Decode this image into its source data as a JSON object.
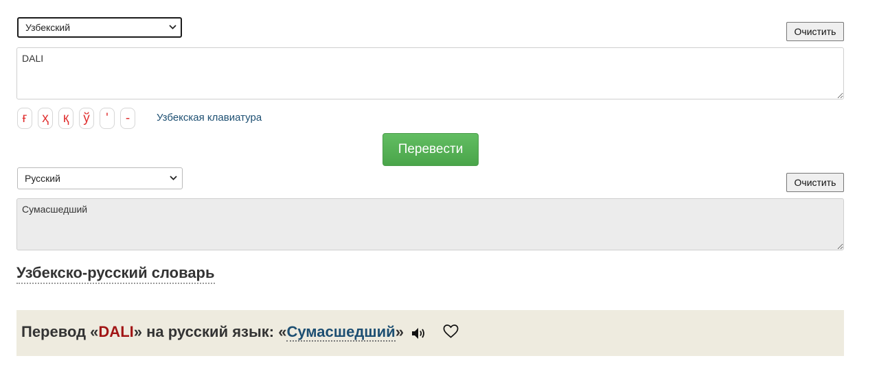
{
  "source": {
    "language": "Узбекский",
    "text": "DALI",
    "clear_label": "Очистить"
  },
  "keyboard": {
    "keys": [
      "ғ",
      "ҳ",
      "қ",
      "ў",
      "'",
      "-"
    ],
    "link_label": "Узбекская клавиатура"
  },
  "translate_label": "Перевести",
  "target": {
    "language": "Русский",
    "text": "Сумасшедший",
    "clear_label": "Очистить"
  },
  "dictionary_title": "Узбекско-русский словарь",
  "result": {
    "prefix": "Перевод «",
    "word": "DALI",
    "middle": "» на русский язык: «",
    "translation": "Сумасшедший",
    "suffix": "»",
    "speaker_icon": "speaker-icon",
    "favorite_icon": "heart-icon"
  }
}
